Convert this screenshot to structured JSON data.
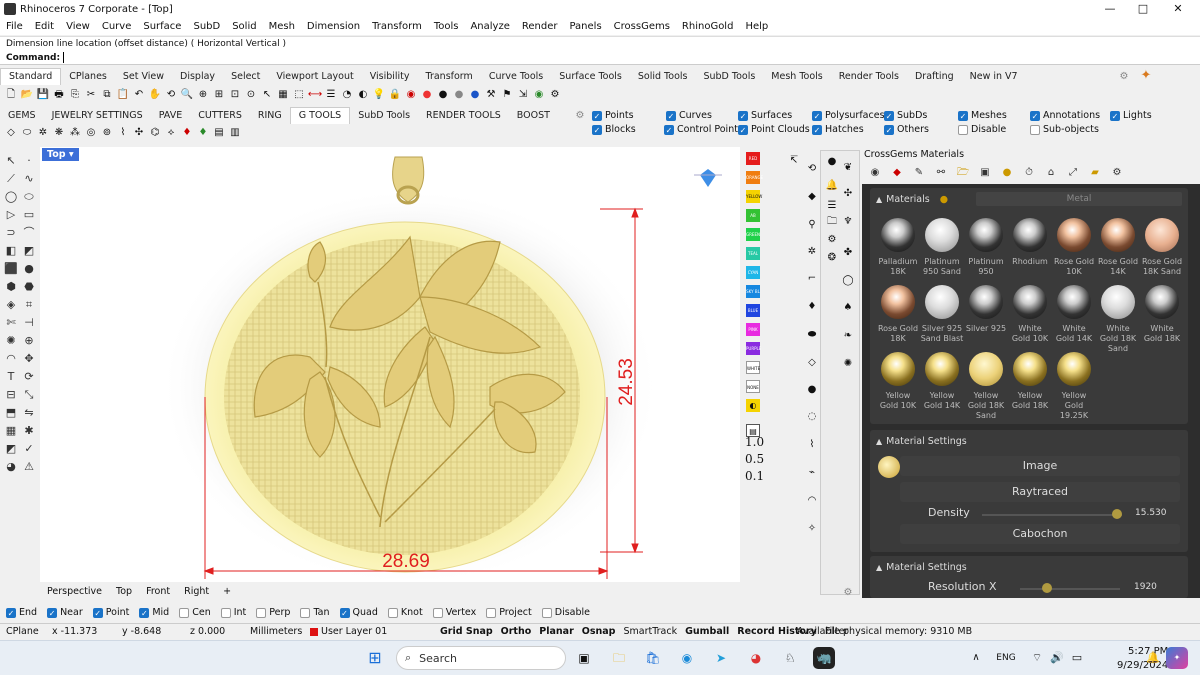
{
  "window": {
    "title": "Rhinoceros 7 Corporate - [Top]",
    "minimize": "—",
    "maximize": "□",
    "close": "✕"
  },
  "menu": [
    "File",
    "Edit",
    "View",
    "Curve",
    "Surface",
    "SubD",
    "Solid",
    "Mesh",
    "Dimension",
    "Transform",
    "Tools",
    "Analyze",
    "Render",
    "Panels",
    "CrossGems",
    "RhinoGold",
    "Help"
  ],
  "command": {
    "history": "Dimension line location (offset distance) ( Horizontal  Vertical )",
    "prompt": "Command:",
    "value": ""
  },
  "toolbar_tabs": [
    "Standard",
    "CPlanes",
    "Set View",
    "Display",
    "Select",
    "Viewport Layout",
    "Visibility",
    "Transform",
    "Curve Tools",
    "Surface Tools",
    "Solid Tools",
    "SubD Tools",
    "Mesh Tools",
    "Render Tools",
    "Drafting",
    "New in V7"
  ],
  "plugin_tabs": [
    "GEMS",
    "JEWELRY SETTINGS",
    "PAVE",
    "CUTTERS",
    "RING",
    "G TOOLS",
    "SubD Tools",
    "RENDER TOOLS",
    "BOOST"
  ],
  "active_plugin_tab": "G TOOLS",
  "filters": [
    {
      "label": "Points",
      "checked": true
    },
    {
      "label": "Curves",
      "checked": true
    },
    {
      "label": "Surfaces",
      "checked": true
    },
    {
      "label": "Polysurfaces",
      "checked": true
    },
    {
      "label": "SubDs",
      "checked": true
    },
    {
      "label": "Meshes",
      "checked": true
    },
    {
      "label": "Annotations",
      "checked": true
    },
    {
      "label": "Lights",
      "checked": true
    },
    {
      "label": "Blocks",
      "checked": true
    },
    {
      "label": "Control Points",
      "checked": true
    },
    {
      "label": "Point Clouds",
      "checked": true
    },
    {
      "label": "Hatches",
      "checked": true
    },
    {
      "label": "Others",
      "checked": true
    },
    {
      "label": "Disable",
      "checked": false
    },
    {
      "label": "Sub-objects",
      "checked": false
    }
  ],
  "viewport": {
    "name": "Top",
    "dim_vertical": "24.53",
    "dim_horizontal": "28.69"
  },
  "viewport_tabs": [
    "Perspective",
    "Top",
    "Front",
    "Right",
    "+"
  ],
  "color_swatches": [
    {
      "label": "RED",
      "color": "#e51c1c"
    },
    {
      "label": "ORANGE",
      "color": "#f07d0f"
    },
    {
      "label": "YELLOW",
      "color": "#f5d300"
    },
    {
      "label": "AB",
      "color": "#33c233"
    },
    {
      "label": "GREEN",
      "color": "#1fd14a"
    },
    {
      "label": "TEAL",
      "color": "#27c9a5"
    },
    {
      "label": "CYAN",
      "color": "#1eb6e8"
    },
    {
      "label": "SKY BL",
      "color": "#1587e0"
    },
    {
      "label": "BLUE",
      "color": "#1f45e0"
    },
    {
      "label": "PINK",
      "color": "#e82be0"
    },
    {
      "label": "PURPLE",
      "color": "#8a2be0"
    },
    {
      "label": "WHITE",
      "color": "#ffffff"
    },
    {
      "label": "NONE",
      "color": "#ffffff"
    }
  ],
  "zoom_labels": [
    "1.0",
    "0.5",
    "0.1"
  ],
  "crossgems": {
    "title": "CrossGems Materials",
    "materials_header": "Materials",
    "category": "Metal",
    "materials": [
      {
        "name": "Palladium 18K",
        "tone": "dark"
      },
      {
        "name": "Platinum 950 Sand",
        "tone": "silver"
      },
      {
        "name": "Platinum 950",
        "tone": "dark"
      },
      {
        "name": "Rhodium",
        "tone": "dark"
      },
      {
        "name": "Rose Gold 10K",
        "tone": "rose"
      },
      {
        "name": "Rose Gold 14K",
        "tone": "rose"
      },
      {
        "name": "Rose Gold 18K Sand",
        "tone": "rosesand"
      },
      {
        "name": "Rose Gold 18K",
        "tone": "rose"
      },
      {
        "name": "Silver 925 Sand Blast",
        "tone": "silver"
      },
      {
        "name": "Silver 925",
        "tone": "dark"
      },
      {
        "name": "White Gold 10K",
        "tone": "dark"
      },
      {
        "name": "White Gold 14K",
        "tone": "dark"
      },
      {
        "name": "White Gold 18K Sand",
        "tone": "silver"
      },
      {
        "name": "White Gold 18K",
        "tone": "dark"
      },
      {
        "name": "Yellow Gold 10K",
        "tone": "gold"
      },
      {
        "name": "Yellow Gold 14K",
        "tone": "gold"
      },
      {
        "name": "Yellow Gold 18K Sand",
        "tone": "goldsand"
      },
      {
        "name": "Yellow Gold 18K",
        "tone": "gold"
      },
      {
        "name": "Yellow Gold 19.25K",
        "tone": "gold"
      }
    ],
    "settings_header": "Material Settings",
    "image_label": "Image",
    "raytraced_label": "Raytraced",
    "density_label": "Density",
    "density_value": "15.530",
    "cabochon_label": "Cabochon",
    "settings2_header": "Material Settings",
    "resolution_label": "Resolution X",
    "resolution_value": "1920"
  },
  "osnaps": [
    {
      "label": "End",
      "checked": true
    },
    {
      "label": "Near",
      "checked": true
    },
    {
      "label": "Point",
      "checked": true
    },
    {
      "label": "Mid",
      "checked": true
    },
    {
      "label": "Cen",
      "checked": false
    },
    {
      "label": "Int",
      "checked": false
    },
    {
      "label": "Perp",
      "checked": false
    },
    {
      "label": "Tan",
      "checked": false
    },
    {
      "label": "Quad",
      "checked": true
    },
    {
      "label": "Knot",
      "checked": false
    },
    {
      "label": "Vertex",
      "checked": false
    },
    {
      "label": "Project",
      "checked": false
    },
    {
      "label": "Disable",
      "checked": false
    }
  ],
  "status": {
    "cplane": "CPlane",
    "x": "x -11.373",
    "y": "y -8.648",
    "z": "z 0.000",
    "units": "Millimeters",
    "layer": "User Layer 01",
    "toggles": [
      "Grid Snap",
      "Ortho",
      "Planar",
      "Osnap",
      "SmartTrack",
      "Gumball",
      "Record History",
      "Filter"
    ],
    "memory": "Available physical memory: 9310 MB"
  },
  "taskbar": {
    "search": "Search",
    "lang": "ENG",
    "time": "5:27 PM",
    "date": "9/29/2024"
  }
}
